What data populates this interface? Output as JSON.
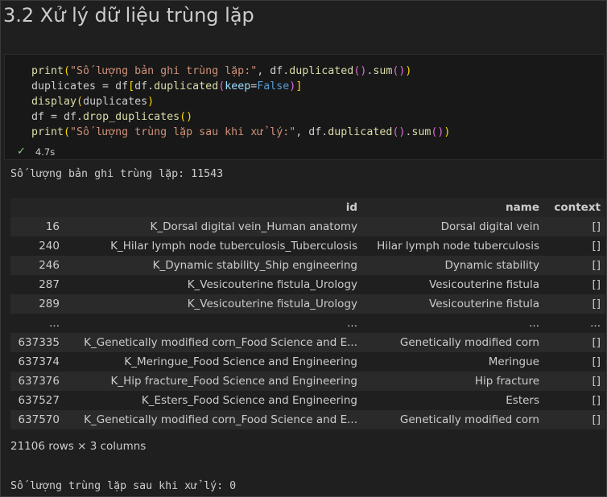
{
  "heading": "3.2 Xử lý dữ liệu trùng lặp",
  "code": {
    "line1": {
      "fn": "print",
      "str": "\"Số lượng bản ghi trùng lặp:\"",
      "rest": ", df.duplicated().sum()"
    },
    "line2": {
      "text": "duplicates = df[df.duplicated(keep=False)]"
    },
    "line3": {
      "text": "display(duplicates)"
    },
    "line4": {
      "text": "df = df.drop_duplicates()"
    },
    "line5": {
      "fn": "print",
      "str": "\"Số lượng trùng lặp sau khi xử lý:\"",
      "rest": ", df.duplicated().sum()"
    }
  },
  "run_status": {
    "icon": "check-icon",
    "duration": "4.7s"
  },
  "output": {
    "line1": "Số lượng bản ghi trùng lặp: 11543",
    "table": {
      "columns": [
        "",
        "id",
        "name",
        "context"
      ],
      "rows": [
        [
          "16",
          "K_Dorsal digital vein_Human anatomy",
          "Dorsal digital vein",
          "[]"
        ],
        [
          "240",
          "K_Hilar lymph node tuberculosis_Tuberculosis",
          "Hilar lymph node tuberculosis",
          "[]"
        ],
        [
          "246",
          "K_Dynamic stability_Ship engineering",
          "Dynamic stability",
          "[]"
        ],
        [
          "287",
          "K_Vesicouterine fistula_Urology",
          "Vesicouterine fistula",
          "[]"
        ],
        [
          "289",
          "K_Vesicouterine fistula_Urology",
          "Vesicouterine fistula",
          "[]"
        ],
        [
          "...",
          "...",
          "...",
          "..."
        ],
        [
          "637335",
          "K_Genetically modified corn_Food Science and E...",
          "Genetically modified corn",
          "[]"
        ],
        [
          "637374",
          "K_Meringue_Food Science and Engineering",
          "Meringue",
          "[]"
        ],
        [
          "637376",
          "K_Hip fracture_Food Science and Engineering",
          "Hip fracture",
          "[]"
        ],
        [
          "637527",
          "K_Esters_Food Science and Engineering",
          "Esters",
          "[]"
        ],
        [
          "637570",
          "K_Genetically modified corn_Food Science and E...",
          "Genetically modified corn",
          "[]"
        ]
      ]
    },
    "shape": "21106 rows × 3 columns",
    "line2": "Số lượng trùng lặp sau khi xử lý: 0"
  },
  "colors": {
    "background": "#1f1f1f",
    "code_background": "#181818",
    "string": "#ce9178",
    "function": "#dcdcaa",
    "keyword": "#569cd6",
    "success": "#89d185"
  }
}
